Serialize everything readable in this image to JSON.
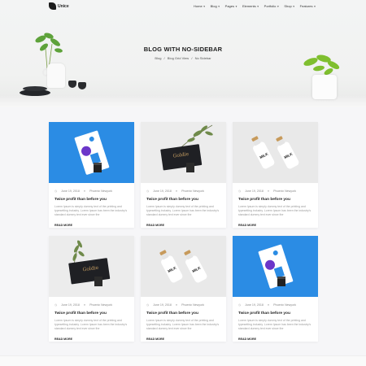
{
  "header": {
    "logo": "Unice",
    "menu": [
      {
        "label": "Home"
      },
      {
        "label": "Blog"
      },
      {
        "label": "Pages"
      },
      {
        "label": "Elements"
      },
      {
        "label": "Portfolio"
      },
      {
        "label": "Shop"
      },
      {
        "label": "Features"
      }
    ]
  },
  "hero": {
    "title": "BLOG WITH NO-SIDEBAR",
    "breadcrumb": [
      "Blog",
      "Blog Grid View",
      "No Sidebar"
    ],
    "breadcrumb_sep": "/"
  },
  "posts": [
    {
      "image": "blue-business-cards",
      "date": "June 19, 2018",
      "author": "Phoenix Newyork",
      "title": "Twice profit than before you",
      "excerpt": "Lorem Ipsum is simply dummy text of the printing and typesetting industry. Lorem Ipsum has been the industry's standard dummy text ever since the",
      "read_more": "READ MORE"
    },
    {
      "image": "goldie-card-plant",
      "date": "June 19, 2018",
      "author": "Phoenix Newyork",
      "title": "Twice profit than before you",
      "excerpt": "Lorem Ipsum is simply dummy text of the printing and typesetting industry. Lorem Ipsum has been the industry's standard dummy text ever since the",
      "read_more": "READ MORE"
    },
    {
      "image": "milk-bottles",
      "date": "June 19, 2018",
      "author": "Phoenix Newyork",
      "title": "Twice profit than before you",
      "excerpt": "Lorem Ipsum is simply dummy text of the printing and typesetting industry. Lorem Ipsum has been the industry's standard dummy text ever since the",
      "read_more": "READ MORE"
    },
    {
      "image": "goldie-card-plant",
      "date": "June 19, 2018",
      "author": "Phoenix Newyork",
      "title": "Twice profit than before you",
      "excerpt": "Lorem Ipsum is simply dummy text of the printing and typesetting industry. Lorem Ipsum has been the industry's standard dummy text ever since the",
      "read_more": "READ MORE"
    },
    {
      "image": "milk-bottles",
      "date": "June 19, 2018",
      "author": "Phoenix Newyork",
      "title": "Twice profit than before you",
      "excerpt": "Lorem Ipsum is simply dummy text of the printing and typesetting industry. Lorem Ipsum has been the industry's standard dummy text ever since the",
      "read_more": "READ MORE"
    },
    {
      "image": "blue-business-cards",
      "date": "June 19, 2018",
      "author": "Phoenix Newyork",
      "title": "Twice profit than before you",
      "excerpt": "Lorem Ipsum is simply dummy text of the printing and typesetting industry. Lorem Ipsum has been the industry's standard dummy text ever since the",
      "read_more": "READ MORE"
    }
  ],
  "card_logo_text": "Goldie",
  "bottle_label": "MILK",
  "colors": {
    "accent_blue": "#2b8ce4",
    "card_dark": "#1f2024",
    "gold": "#c9a063",
    "purple": "#6b36c9"
  },
  "icons": {
    "date": "clock-icon",
    "author": "user-icon",
    "dropdown": "chevron-down-icon"
  }
}
